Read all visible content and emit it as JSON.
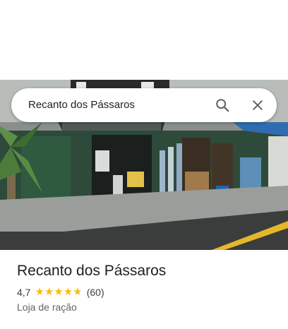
{
  "search": {
    "query": "Recanto dos Pássaros",
    "search_icon": "search-icon",
    "close_icon": "close-icon"
  },
  "photo": {
    "icon": "street-view-photo"
  },
  "place": {
    "name": "Recanto dos Pássaros",
    "rating_text": "4,7",
    "rating": 4.7,
    "star_color": "#fbbc04",
    "reviews_text": "(60)",
    "category": "Loja de ração"
  }
}
